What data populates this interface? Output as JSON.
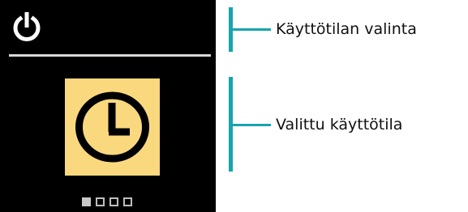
{
  "device": {
    "header_icon": "power-icon",
    "selected_mode_icon": "clock-icon",
    "page_indicator": {
      "total_pages": 4,
      "active_page": 1
    }
  },
  "callouts": {
    "mode_selection_label": "Käyttötilan valinta",
    "selected_mode_label": "Valittu käyttötila"
  },
  "colors": {
    "screen_background": "#000000",
    "mode_tile": "#fad97e",
    "callout_bracket": "#17a4ae"
  }
}
